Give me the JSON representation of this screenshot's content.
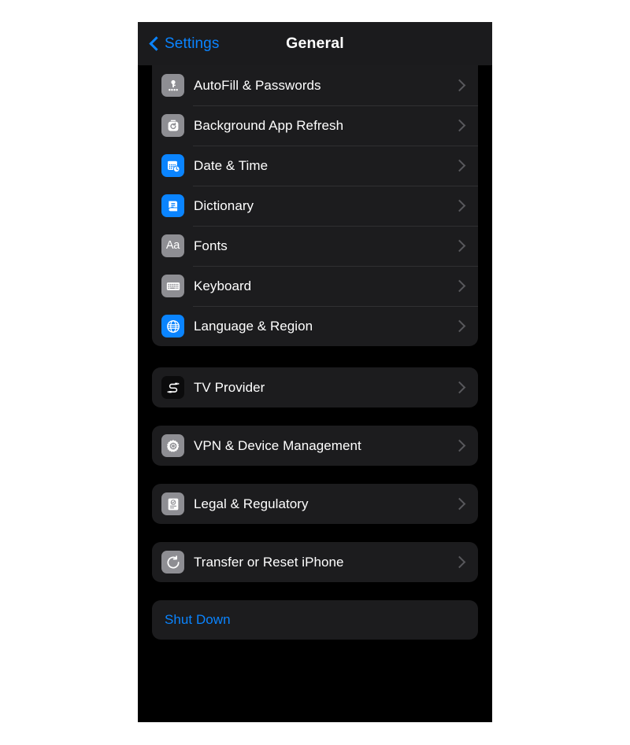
{
  "nav": {
    "back_label": "Settings",
    "back_icon": "chevron-left-icon",
    "title": "General"
  },
  "colors": {
    "accent": "#0a84ff",
    "row_background": "#1c1c1e",
    "screen_background": "#000000",
    "navbar_background": "#1b1b1d",
    "icon_gray": "#8e8e93",
    "separator": "#303032",
    "chevron": "#58585c",
    "label": "#ffffff"
  },
  "groups": [
    {
      "id": "group-settings-primary",
      "partial_top": true,
      "rows": [
        {
          "label": "AutoFill & Passwords",
          "icon": "key-passwords-icon",
          "tile": "gray",
          "chevron": true
        },
        {
          "label": "Background App Refresh",
          "icon": "app-refresh-icon",
          "tile": "gray",
          "chevron": true
        },
        {
          "label": "Date & Time",
          "icon": "calendar-clock-icon",
          "tile": "blue",
          "chevron": true
        },
        {
          "label": "Dictionary",
          "icon": "book-icon",
          "tile": "blue",
          "chevron": true
        },
        {
          "label": "Fonts",
          "icon": "fonts-aa-icon",
          "tile": "gray",
          "chevron": true,
          "glyph_text": "Aa"
        },
        {
          "label": "Keyboard",
          "icon": "keyboard-icon",
          "tile": "gray",
          "chevron": true
        },
        {
          "label": "Language & Region",
          "icon": "globe-icon",
          "tile": "blue",
          "chevron": true
        }
      ]
    },
    {
      "id": "group-tv-provider",
      "partial_top": false,
      "rows": [
        {
          "label": "TV Provider",
          "icon": "tv-provider-icon",
          "tile": "black",
          "chevron": true
        }
      ]
    },
    {
      "id": "group-vpn",
      "partial_top": false,
      "rows": [
        {
          "label": "VPN & Device Management",
          "icon": "gear-icon",
          "tile": "gray",
          "chevron": true
        }
      ]
    },
    {
      "id": "group-legal",
      "partial_top": false,
      "rows": [
        {
          "label": "Legal & Regulatory",
          "icon": "document-seal-icon",
          "tile": "gray",
          "chevron": true
        }
      ]
    },
    {
      "id": "group-transfer-reset",
      "partial_top": false,
      "rows": [
        {
          "label": "Transfer or Reset iPhone",
          "icon": "reset-arrow-icon",
          "tile": "gray",
          "chevron": true
        }
      ]
    },
    {
      "id": "group-shut-down",
      "partial_top": false,
      "rows": [
        {
          "label": "Shut Down",
          "icon": null,
          "tile": null,
          "chevron": false,
          "accent": true
        }
      ]
    }
  ]
}
